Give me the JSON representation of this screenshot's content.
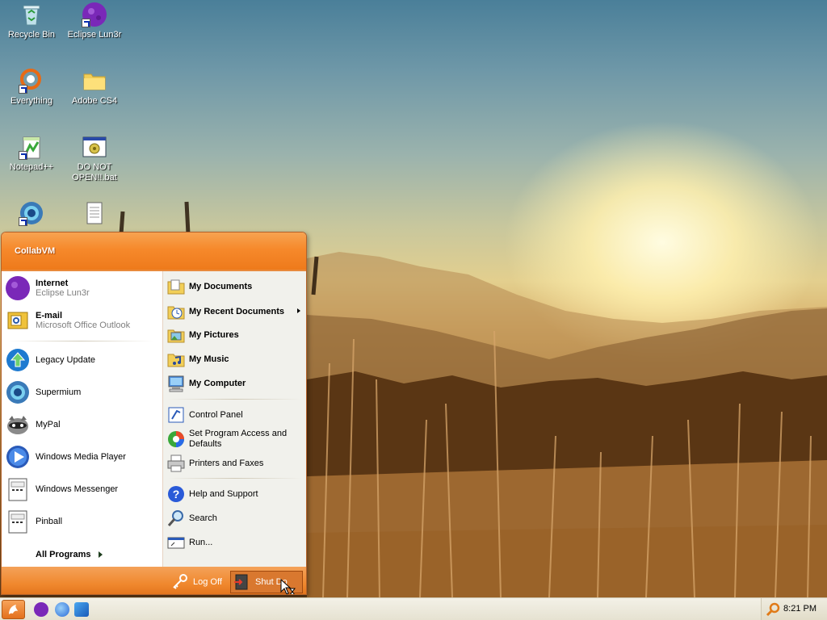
{
  "desktop_icons": [
    {
      "label": "Recycle Bin",
      "icon": "recycle-bin-icon"
    },
    {
      "label": "Eclipse Lun3r",
      "icon": "eclipse-lun3r-icon"
    },
    {
      "label": "Everything",
      "icon": "everything-icon"
    },
    {
      "label": "Adobe CS4",
      "icon": "folder-icon"
    },
    {
      "label": "Notepad++",
      "icon": "notepad-plus-plus-icon"
    },
    {
      "label": "DO NOT OPEN!!.bat",
      "icon": "batch-file-icon"
    },
    {
      "label": "",
      "icon": "supermium-icon"
    },
    {
      "label": "",
      "icon": "text-document-icon"
    }
  ],
  "start_menu": {
    "user_name": "CollabVM",
    "pinned": [
      {
        "title": "Internet",
        "subtitle": "Eclipse Lun3r",
        "icon": "eclipse-lun3r-icon"
      },
      {
        "title": "E-mail",
        "subtitle": "Microsoft Office Outlook",
        "icon": "outlook-icon"
      }
    ],
    "recent_programs": [
      {
        "label": "Legacy Update",
        "icon": "legacy-update-icon"
      },
      {
        "label": "Supermium",
        "icon": "supermium-icon"
      },
      {
        "label": "MyPal",
        "icon": "mypal-icon"
      },
      {
        "label": "Windows Media Player",
        "icon": "media-player-icon"
      },
      {
        "label": "Windows Messenger",
        "icon": "messenger-icon"
      },
      {
        "label": "Pinball",
        "icon": "pinball-icon"
      }
    ],
    "all_programs_label": "All Programs",
    "places": [
      {
        "label": "My Documents",
        "icon": "my-documents-icon"
      },
      {
        "label": "My Recent Documents",
        "icon": "recent-documents-icon"
      },
      {
        "label": "My Pictures",
        "icon": "my-pictures-icon"
      },
      {
        "label": "My Music",
        "icon": "my-music-icon"
      },
      {
        "label": "My Computer",
        "icon": "my-computer-icon"
      }
    ],
    "settings": [
      {
        "label": "Control Panel",
        "icon": "control-panel-icon"
      },
      {
        "label": "Set Program Access and Defaults",
        "icon": "program-defaults-icon"
      },
      {
        "label": "Printers and Faxes",
        "icon": "printer-icon"
      }
    ],
    "tools": [
      {
        "label": "Help and Support",
        "icon": "help-icon"
      },
      {
        "label": "Search",
        "icon": "search-icon"
      },
      {
        "label": "Run...",
        "icon": "run-icon"
      }
    ],
    "log_off_label": "Log Off",
    "shut_down_label": "Shut Do"
  },
  "taskbar": {
    "clock": "8:21 PM",
    "quick_launch": [
      "eclipse-lun3r-icon",
      "internet-explorer-icon",
      "supermium-icon"
    ]
  },
  "colors": {
    "accent": "#f0882e",
    "header": "#f6892b"
  }
}
